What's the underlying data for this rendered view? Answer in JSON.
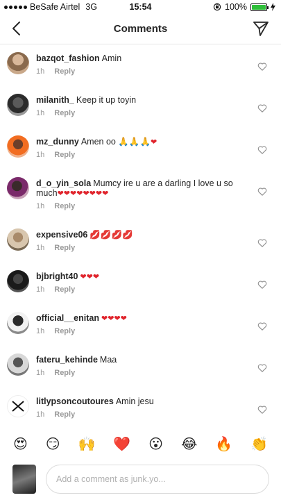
{
  "status_bar": {
    "carrier": "BeSafe Airtel",
    "network": "3G",
    "time": "15:54",
    "battery": "100%",
    "battery_level": 1.0
  },
  "header": {
    "title": "Comments"
  },
  "comments": [
    {
      "username": "bazqot_fashion",
      "text": "Amin",
      "time": "1h",
      "reply_label": "Reply"
    },
    {
      "username": "milanith_",
      "text": "Keep it up toyin",
      "time": "1h",
      "reply_label": "Reply"
    },
    {
      "username": "mz_dunny",
      "text": "Amen oo",
      "emoji": "🙏🙏🙏",
      "hearts": "❤",
      "time": "1h",
      "reply_label": "Reply"
    },
    {
      "username": "d_o_yin_sola",
      "text": "Mumcy ire u are a darling I love u so much",
      "hearts": "❤❤❤❤❤❤❤❤",
      "time": "1h",
      "reply_label": "Reply"
    },
    {
      "username": "expensive06",
      "text": "",
      "emoji": "💋💋💋💋",
      "time": "1h",
      "reply_label": "Reply"
    },
    {
      "username": "bjbright40",
      "text": "",
      "hearts": "❤❤❤",
      "time": "1h",
      "reply_label": "Reply"
    },
    {
      "username": "official__enitan",
      "text": "",
      "hearts": "❤❤❤❤",
      "time": "1h",
      "reply_label": "Reply"
    },
    {
      "username": "fateru_kehinde",
      "text": "Maa",
      "time": "1h",
      "reply_label": "Reply"
    },
    {
      "username": "litlypsoncoutoures",
      "text": "Amin jesu",
      "time": "1h",
      "reply_label": "Reply"
    }
  ],
  "emoji_bar": [
    "😍",
    "😏",
    "🙌",
    "❤️",
    "😮",
    "😂",
    "🔥",
    "👏"
  ],
  "composer": {
    "placeholder": "Add a comment as junk.yo..."
  },
  "colors": {
    "heart": "#e0242c",
    "meta_text": "#999999",
    "battery": "#2fbf3a"
  }
}
